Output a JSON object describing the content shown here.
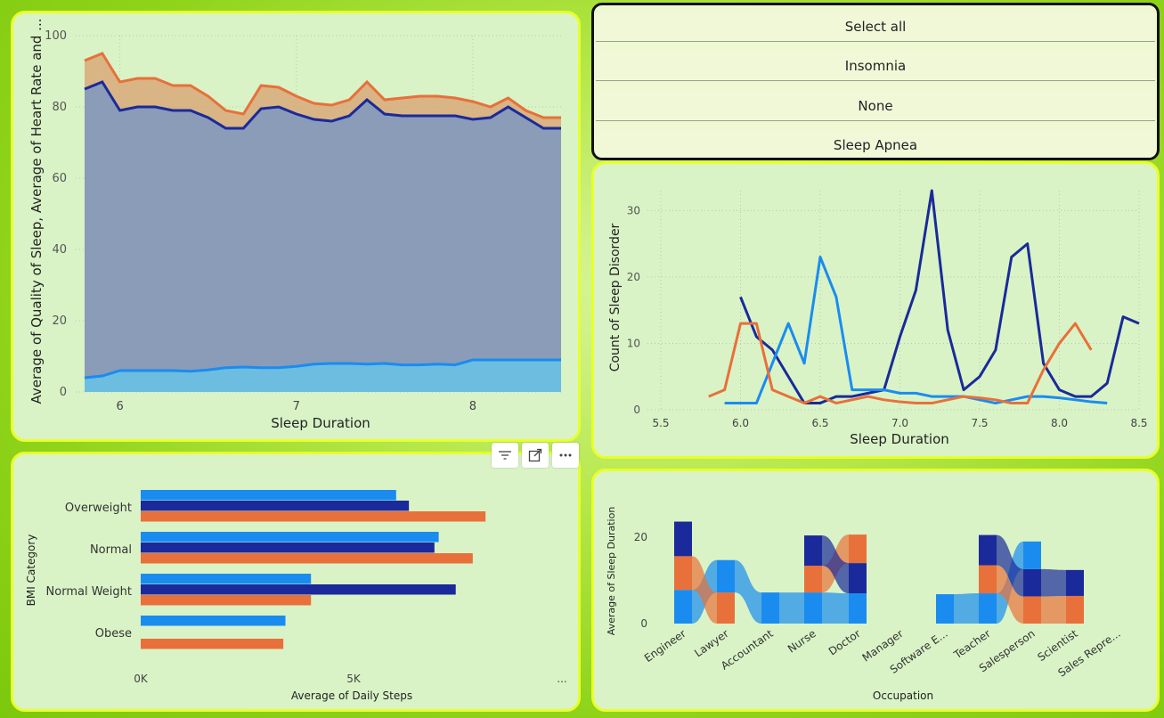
{
  "colors": {
    "orange": "#e8703a",
    "navy": "#1a2a9a",
    "blue": "#1a8cf0",
    "lightblue": "#5ab4f0"
  },
  "area_chart": {
    "ylabel": "Average of Quality of Sleep, Average of Heart Rate and ...",
    "xlabel": "Sleep Duration",
    "yticks": [
      "100",
      "80",
      "60",
      "40",
      "20",
      "0"
    ],
    "xticks": [
      "6",
      "7",
      "8"
    ]
  },
  "slicer": {
    "items": [
      "Select all",
      "Insomnia",
      "None",
      "Sleep Apnea"
    ]
  },
  "line_chart": {
    "ylabel": "Count of Sleep Disorder",
    "xlabel": "Sleep Duration",
    "yticks": [
      "30",
      "20",
      "10",
      "0"
    ],
    "xticks": [
      "5.5",
      "6.0",
      "6.5",
      "7.0",
      "7.5",
      "8.0",
      "8.5"
    ]
  },
  "bar_chart": {
    "ylabel": "BMI Category",
    "xlabel": "Average of Daily Steps",
    "categories": [
      "Overweight",
      "Normal",
      "Normal Weight",
      "Obese"
    ],
    "xticks": [
      "0K",
      "5K",
      "..."
    ]
  },
  "ribbon_chart": {
    "ylabel": "Average of Sleep Duration",
    "xlabel": "Occupation",
    "yticks": [
      "20",
      "0"
    ],
    "categories": [
      "Engineer",
      "Lawyer",
      "Accountant",
      "Nurse",
      "Doctor",
      "Manager",
      "Software E...",
      "Teacher",
      "Salesperson",
      "Scientist",
      "Sales Repre..."
    ]
  },
  "chart_data": [
    {
      "type": "area",
      "xlabel": "Sleep Duration",
      "ylabel": "Average of Quality of Sleep, Average of Heart Rate and ...",
      "ylim": [
        0,
        100
      ],
      "x": [
        5.8,
        5.9,
        6.0,
        6.1,
        6.2,
        6.3,
        6.4,
        6.5,
        6.6,
        6.7,
        6.8,
        6.9,
        7.0,
        7.1,
        7.2,
        7.3,
        7.4,
        7.5,
        7.6,
        7.7,
        7.8,
        7.9,
        8.0,
        8.1,
        8.2,
        8.3,
        8.4,
        8.5
      ],
      "series": [
        {
          "values": [
            93,
            95,
            87,
            88,
            88,
            86,
            86,
            83,
            79,
            78,
            86,
            85.5,
            83,
            81,
            80.5,
            82,
            87,
            82,
            82.5,
            83,
            83,
            82.5,
            81.5,
            80,
            82.5,
            79,
            77,
            77
          ]
        },
        {
          "values": [
            85,
            87,
            79,
            80,
            80,
            79,
            79,
            77,
            74,
            74,
            79.5,
            80,
            78,
            76.5,
            76,
            77.5,
            82,
            78,
            77.5,
            77.5,
            77.5,
            77.5,
            76.5,
            77,
            80,
            77,
            74,
            74
          ]
        },
        {
          "values": [
            4,
            4.5,
            6,
            6,
            6,
            6,
            5.8,
            6.2,
            6.8,
            7,
            6.8,
            6.8,
            7.2,
            7.8,
            8,
            8,
            7.8,
            8,
            7.6,
            7.6,
            7.8,
            7.6,
            9,
            9,
            9,
            9,
            9,
            9
          ]
        }
      ]
    },
    {
      "type": "line",
      "xlabel": "Sleep Duration",
      "ylabel": "Count of Sleep Disorder",
      "xlim": [
        5.5,
        8.5
      ],
      "ylim": [
        0,
        33
      ],
      "series": [
        {
          "x": [
            6.0,
            6.1,
            6.2,
            6.3,
            6.4,
            6.5,
            6.6,
            6.7,
            6.8,
            6.9,
            7.0,
            7.1,
            7.2,
            7.3,
            7.4,
            7.5,
            7.6,
            7.7,
            7.8,
            7.9,
            8.0,
            8.1,
            8.2,
            8.3,
            8.4,
            8.5
          ],
          "values": [
            17,
            11,
            9,
            5,
            1,
            1,
            2,
            2,
            2.5,
            3,
            11,
            18,
            33,
            12,
            3,
            5,
            9,
            23,
            25,
            7,
            3,
            2,
            2,
            4,
            14,
            13
          ]
        },
        {
          "x": [
            5.9,
            6.0,
            6.1,
            6.2,
            6.3,
            6.4,
            6.5,
            6.6,
            6.7,
            6.8,
            6.9,
            7.0,
            7.1,
            7.2,
            7.3,
            7.4,
            7.5,
            7.6,
            7.7,
            7.8,
            7.9,
            8.0,
            8.1,
            8.2,
            8.3
          ],
          "values": [
            1,
            1,
            1,
            7,
            13,
            7,
            23,
            17,
            3,
            3,
            3,
            2.5,
            2.5,
            2,
            2,
            2,
            1.5,
            1,
            1.5,
            2,
            2,
            1.8,
            1.5,
            1.2,
            1
          ]
        },
        {
          "x": [
            5.8,
            5.9,
            6.0,
            6.1,
            6.2,
            6.3,
            6.4,
            6.5,
            6.6,
            6.7,
            6.8,
            6.9,
            7.0,
            7.1,
            7.2,
            7.3,
            7.4,
            7.5,
            7.6,
            7.7,
            7.8,
            7.9,
            8.0,
            8.1,
            8.2
          ],
          "values": [
            2,
            3,
            13,
            13,
            3,
            2,
            1,
            2,
            1,
            1.5,
            2,
            1.5,
            1.2,
            1,
            1,
            1.5,
            2,
            1.8,
            1.5,
            1,
            1,
            6,
            10,
            13,
            9
          ]
        }
      ]
    },
    {
      "type": "bar",
      "xlabel": "Average of Daily Steps",
      "ylabel": "BMI Category",
      "categories": [
        "Overweight",
        "Normal",
        "Normal Weight",
        "Obese"
      ],
      "xlim": [
        0,
        10000
      ],
      "series": [
        {
          "values": [
            6000,
            7000,
            4000,
            3400
          ]
        },
        {
          "values": [
            6300,
            6900,
            7400,
            null
          ]
        },
        {
          "values": [
            8100,
            7800,
            4000,
            3350
          ]
        }
      ]
    },
    {
      "type": "bar",
      "xlabel": "Occupation",
      "ylabel": "Average of Sleep Duration",
      "categories": [
        "Engineer",
        "Lawyer",
        "Accountant",
        "Nurse",
        "Doctor",
        "Manager",
        "Software E...",
        "Teacher",
        "Salesperson",
        "Scientist",
        "Sales Repre..."
      ],
      "ylim": [
        0,
        25
      ],
      "series": [
        {
          "values": [
            7.8,
            7.5,
            7.2,
            7.2,
            7.0,
            6.9,
            6.8,
            7.0,
            6.4,
            0,
            0
          ]
        },
        {
          "values": [
            8.0,
            0,
            0,
            7.0,
            7.0,
            0,
            0,
            7.0,
            6.3,
            6.0,
            5.9
          ]
        },
        {
          "values": [
            7.8,
            7.2,
            7.1,
            6.2,
            6.6,
            0,
            7.2,
            6.5,
            6.3,
            6.4,
            0
          ]
        }
      ]
    }
  ]
}
